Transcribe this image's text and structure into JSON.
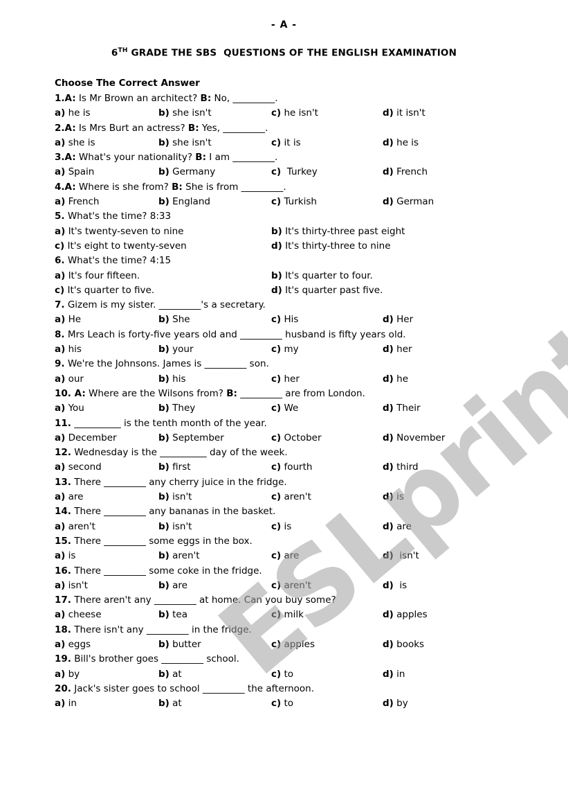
{
  "header": {
    "page_letter": "- A -",
    "title_grade": "6",
    "title_sup": "TH",
    "title_rest": " GRADE THE SBS  QUESTIONS OF THE ENGLISH EXAMINATION"
  },
  "instructions": "Choose The Correct Answer",
  "watermark": "ESLprintables.com",
  "watermark_color": "#a0a0a0",
  "questions": [
    {
      "num": "1.",
      "parts": [
        {
          "s": "A:",
          "t": " Is Mr Brown an architect? "
        },
        {
          "s": "B:",
          "t": " No, _________."
        }
      ],
      "layout": "four",
      "options": [
        {
          "l": "a)",
          "t": " he is"
        },
        {
          "l": "b)",
          "t": " she isn't"
        },
        {
          "l": "c)",
          "t": " he isn't"
        },
        {
          "l": "d)",
          "t": " it isn't"
        }
      ]
    },
    {
      "num": "2.",
      "parts": [
        {
          "s": "A:",
          "t": " Is Mrs Burt an actress? "
        },
        {
          "s": "B:",
          "t": " Yes, _________."
        }
      ],
      "layout": "four",
      "options": [
        {
          "l": "a)",
          "t": " she is"
        },
        {
          "l": "b)",
          "t": " she isn't"
        },
        {
          "l": "c)",
          "t": " it is"
        },
        {
          "l": "d)",
          "t": " he is"
        }
      ]
    },
    {
      "num": "3.",
      "parts": [
        {
          "s": "A:",
          "t": " What's your nationality? "
        },
        {
          "s": "B:",
          "t": " I am _________."
        }
      ],
      "layout": "four",
      "options": [
        {
          "l": "a)",
          "t": " Spain"
        },
        {
          "l": "b)",
          "t": " Germany"
        },
        {
          "l": "c)",
          "t": "  Turkey"
        },
        {
          "l": "d)",
          "t": " French"
        }
      ]
    },
    {
      "num": "4.",
      "parts": [
        {
          "s": "A:",
          "t": " Where is she from? "
        },
        {
          "s": "B:",
          "t": " She is from _________."
        }
      ],
      "layout": "four",
      "options": [
        {
          "l": "a)",
          "t": " French"
        },
        {
          "l": "b)",
          "t": " England"
        },
        {
          "l": "c)",
          "t": " Turkish"
        },
        {
          "l": "d)",
          "t": " German"
        }
      ]
    },
    {
      "num": "5.",
      "parts": [
        {
          "s": "",
          "t": " What's the time? 8:33"
        }
      ],
      "layout": "two",
      "options": [
        {
          "l": "a)",
          "t": " It's twenty-seven to nine"
        },
        {
          "l": "b)",
          "t": " It's thirty-three past eight"
        },
        {
          "l": "c)",
          "t": " It's eight to twenty-seven"
        },
        {
          "l": "d)",
          "t": " It's thirty-three to nine"
        }
      ]
    },
    {
      "num": "6.",
      "parts": [
        {
          "s": "",
          "t": " What's the time? 4:15"
        }
      ],
      "layout": "two",
      "options": [
        {
          "l": "a)",
          "t": " It's four fifteen."
        },
        {
          "l": "b)",
          "t": " It's quarter to four."
        },
        {
          "l": "c)",
          "t": " It's quarter to five."
        },
        {
          "l": "d)",
          "t": " It's quarter past five."
        }
      ]
    },
    {
      "num": "7.",
      "parts": [
        {
          "s": "",
          "t": " Gizem is my sister. _________'s a secretary."
        }
      ],
      "layout": "four",
      "options": [
        {
          "l": "a)",
          "t": " He"
        },
        {
          "l": "b)",
          "t": " She"
        },
        {
          "l": "c)",
          "t": " His"
        },
        {
          "l": "d)",
          "t": " Her"
        }
      ]
    },
    {
      "num": "8.",
      "parts": [
        {
          "s": "",
          "t": " Mrs Leach is forty-five years old and _________ husband is fifty years old."
        }
      ],
      "layout": "four",
      "options": [
        {
          "l": "a)",
          "t": " his"
        },
        {
          "l": "b)",
          "t": " your"
        },
        {
          "l": "c)",
          "t": " my"
        },
        {
          "l": "d)",
          "t": " her"
        }
      ]
    },
    {
      "num": "9.",
      "parts": [
        {
          "s": "",
          "t": " We're the Johnsons. James is _________ son."
        }
      ],
      "layout": "four",
      "options": [
        {
          "l": "a)",
          "t": " our"
        },
        {
          "l": "b)",
          "t": " his"
        },
        {
          "l": "c)",
          "t": " her"
        },
        {
          "l": "d)",
          "t": " he"
        }
      ]
    },
    {
      "num": "10.",
      "parts": [
        {
          "s": " A:",
          "t": " Where are the Wilsons from? "
        },
        {
          "s": "B:",
          "t": " _________ are from London."
        }
      ],
      "layout": "four",
      "options": [
        {
          "l": "a)",
          "t": " You"
        },
        {
          "l": "b)",
          "t": " They"
        },
        {
          "l": "c)",
          "t": " We"
        },
        {
          "l": "d)",
          "t": " Their"
        }
      ]
    },
    {
      "num": "11.",
      "parts": [
        {
          "s": "",
          "t": " __________ is the tenth month of the year."
        }
      ],
      "layout": "four",
      "options": [
        {
          "l": "a)",
          "t": " December"
        },
        {
          "l": "b)",
          "t": " September"
        },
        {
          "l": "c)",
          "t": " October"
        },
        {
          "l": "d)",
          "t": " November"
        }
      ]
    },
    {
      "num": "12.",
      "parts": [
        {
          "s": "",
          "t": " Wednesday is the __________ day of the week."
        }
      ],
      "layout": "four",
      "options": [
        {
          "l": "a)",
          "t": " second"
        },
        {
          "l": "b)",
          "t": " first"
        },
        {
          "l": "c)",
          "t": " fourth"
        },
        {
          "l": "d)",
          "t": " third"
        }
      ]
    },
    {
      "num": "13.",
      "parts": [
        {
          "s": "",
          "t": " There _________ any cherry juice in the fridge."
        }
      ],
      "layout": "four",
      "options": [
        {
          "l": "a)",
          "t": " are"
        },
        {
          "l": "b)",
          "t": " isn't"
        },
        {
          "l": "c)",
          "t": " aren't"
        },
        {
          "l": "d)",
          "t": " is"
        }
      ]
    },
    {
      "num": "14.",
      "parts": [
        {
          "s": "",
          "t": " There _________ any bananas in the basket."
        }
      ],
      "layout": "four",
      "options": [
        {
          "l": "a)",
          "t": " aren't"
        },
        {
          "l": "b)",
          "t": " isn't"
        },
        {
          "l": "c)",
          "t": " is"
        },
        {
          "l": "d)",
          "t": " are"
        }
      ]
    },
    {
      "num": "15.",
      "parts": [
        {
          "s": "",
          "t": " There _________ some eggs in the box."
        }
      ],
      "layout": "four",
      "options": [
        {
          "l": "a)",
          "t": " is"
        },
        {
          "l": "b)",
          "t": " aren't"
        },
        {
          "l": "c)",
          "t": " are"
        },
        {
          "l": "d)",
          "t": "  isn't"
        }
      ]
    },
    {
      "num": "16.",
      "parts": [
        {
          "s": "",
          "t": " There _________ some coke in the fridge."
        }
      ],
      "layout": "four",
      "options": [
        {
          "l": "a)",
          "t": " isn't"
        },
        {
          "l": "b)",
          "t": " are"
        },
        {
          "l": "c)",
          "t": " aren't"
        },
        {
          "l": "d)",
          "t": "  is"
        }
      ]
    },
    {
      "num": "17.",
      "parts": [
        {
          "s": "",
          "t": " There aren't any _________ at home. Can you buy some?"
        }
      ],
      "layout": "four",
      "options": [
        {
          "l": "a)",
          "t": " cheese"
        },
        {
          "l": "b)",
          "t": " tea"
        },
        {
          "l": "c)",
          "t": " milk"
        },
        {
          "l": "d)",
          "t": " apples"
        }
      ]
    },
    {
      "num": "18.",
      "parts": [
        {
          "s": "",
          "t": " There isn't any _________ in the fridge."
        }
      ],
      "layout": "four",
      "options": [
        {
          "l": "a)",
          "t": " eggs"
        },
        {
          "l": "b)",
          "t": " butter"
        },
        {
          "l": "c)",
          "t": " apples"
        },
        {
          "l": "d)",
          "t": " books"
        }
      ]
    },
    {
      "num": "19.",
      "parts": [
        {
          "s": "",
          "t": " Bill's brother goes _________ school."
        }
      ],
      "layout": "four",
      "options": [
        {
          "l": "a)",
          "t": " by"
        },
        {
          "l": "b)",
          "t": " at"
        },
        {
          "l": "c)",
          "t": " to"
        },
        {
          "l": "d)",
          "t": " in"
        }
      ]
    },
    {
      "num": "20.",
      "parts": [
        {
          "s": "",
          "t": " Jack's sister goes to school _________ the afternoon."
        }
      ],
      "layout": "four",
      "options": [
        {
          "l": "a)",
          "t": " in"
        },
        {
          "l": "b)",
          "t": " at"
        },
        {
          "l": "c)",
          "t": " to"
        },
        {
          "l": "d)",
          "t": " by"
        }
      ]
    }
  ]
}
